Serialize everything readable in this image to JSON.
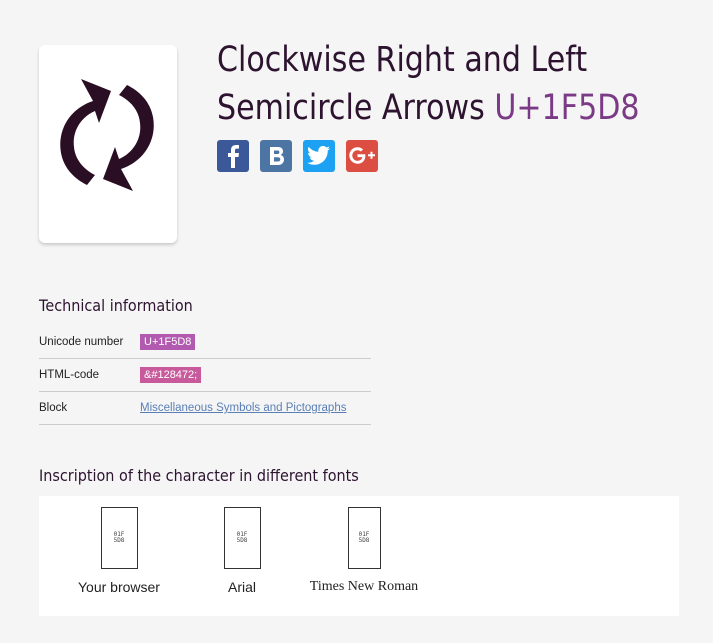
{
  "character": {
    "name": "Clockwise Right and Left Semicircle Arrows",
    "title_line1": "Clockwise Right and Left",
    "title_line2": "Semicircle Arrows",
    "code": "U+1F5D8",
    "glyph_color": "#2a0e24"
  },
  "share": [
    {
      "network": "Facebook",
      "icon": "facebook-icon",
      "glyph": "f",
      "color": "#3b5998"
    },
    {
      "network": "VKontakte",
      "icon": "vk-icon",
      "glyph": "B",
      "color": "#4c75a3"
    },
    {
      "network": "Twitter",
      "icon": "twitter-icon",
      "glyph": "twitter-bird",
      "color": "#1da1f2"
    },
    {
      "network": "Google+",
      "icon": "google-plus-icon",
      "glyph": "g+",
      "color": "#dc4e41"
    }
  ],
  "technical": {
    "heading": "Technical information",
    "rows": [
      {
        "label": "Unicode number",
        "value": "U+1F5D8"
      },
      {
        "label": "HTML-code",
        "value": "&#128472;"
      },
      {
        "label": "Block",
        "value": "Miscellaneous Symbols and Pictographs"
      }
    ]
  },
  "fonts": {
    "heading": "Inscription of the character in different fonts",
    "tofu_text": "01F5D8",
    "samples": [
      {
        "label": "Your browser"
      },
      {
        "label": "Arial"
      },
      {
        "label": "Times New Roman"
      }
    ]
  },
  "colors": {
    "background": "#f5f5f5",
    "title": "#2d1330",
    "code": "#7b3a85",
    "badge": "#b25ab0",
    "link": "#5a7fb5"
  }
}
